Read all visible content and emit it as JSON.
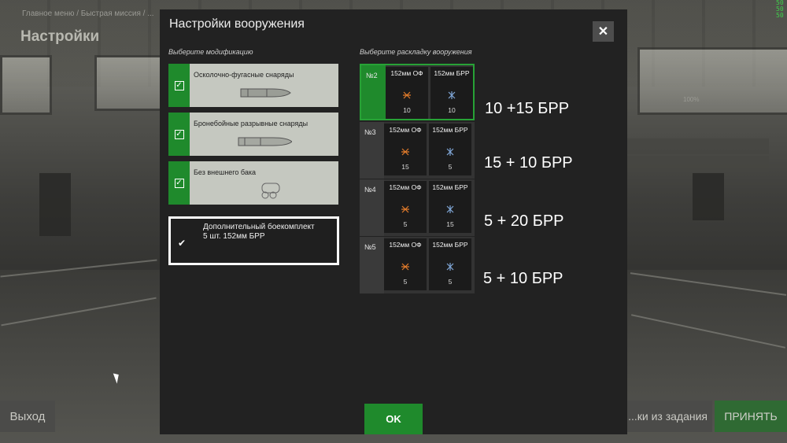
{
  "background": {
    "breadcrumb": "Главное меню / Быстрая миссия / ...",
    "title": "Настройки",
    "exit_label": "Выход",
    "skip_label": "...ки из задания",
    "accept_label": "ПРИНЯТЬ",
    "percent": "100%",
    "counter": "50\n50\n50"
  },
  "dialog": {
    "title": "Настройки вооружения",
    "close_icon": "close-icon",
    "modifications_label": "Выберите модификацию",
    "loadouts_label": "Выберите раскладку вооружения",
    "modifications": [
      {
        "name": "Осколочно-фугасные снаряды",
        "checked": true,
        "icon": "he-shell-icon"
      },
      {
        "name": "Бронебойные разрывные снаряды",
        "checked": true,
        "icon": "ap-shell-icon"
      },
      {
        "name": "Без внешнего бака",
        "checked": true,
        "icon": "fuel-tank-icon"
      }
    ],
    "extra_ammo": {
      "line1": "Дополнительный боекомплект",
      "line2": "5 шт. 152мм БРР",
      "checked": true
    },
    "loadouts": [
      {
        "number": "№2",
        "selected": true,
        "a_name": "152мм ОФ",
        "a_count": "10",
        "b_name": "152мм БРР",
        "b_count": "10"
      },
      {
        "number": "№3",
        "selected": false,
        "a_name": "152мм ОФ",
        "a_count": "15",
        "b_name": "152мм БРР",
        "b_count": "5"
      },
      {
        "number": "№4",
        "selected": false,
        "a_name": "152мм ОФ",
        "a_count": "5",
        "b_name": "152мм БРР",
        "b_count": "15"
      },
      {
        "number": "№5",
        "selected": false,
        "a_name": "152мм ОФ",
        "a_count": "5",
        "b_name": "152мм БРР",
        "b_count": "5"
      }
    ],
    "notes": [
      "10 +15 БРР",
      "15 + 10 БРР",
      "5 + 20 БРР",
      "5 + 10 БРР"
    ],
    "ok_label": "OK",
    "accent_color": "#1f8a2c"
  }
}
